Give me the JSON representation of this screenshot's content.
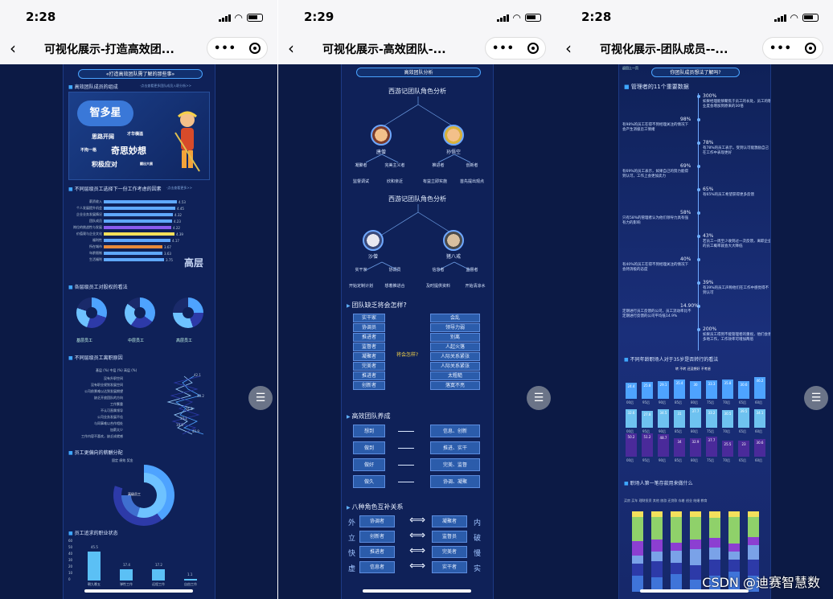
{
  "phones": [
    {
      "time": "2:28",
      "title": "可视化展示-打造高效团...",
      "banner": "«打造高效团队需了解的那些事»"
    },
    {
      "time": "2:29",
      "title": "可视化展示-高效团队-...",
      "banner": "高效团队分析"
    },
    {
      "time": "2:28",
      "title": "可视化展示-团队成员--...",
      "banner": "你团队成员想法了解吗?",
      "top_label": "返回上一页"
    }
  ],
  "p1": {
    "sec1": "高效团队成员的组成",
    "sec1_sub": "·点击查看更多团队成员入职分析>>",
    "speech": "智多星",
    "hero_words": [
      "思路开阔",
      "才华横溢",
      "不拘一格",
      "奇思妙想",
      "积极应对",
      "翻出大展"
    ],
    "sec2": "不同层级员工选择下一份工作考虑的因素",
    "sec2_sub": "·点击查看更多>>",
    "bars": [
      {
        "label": "薪资收入",
        "value": 4.53,
        "color": "#5fa8ff"
      },
      {
        "label": "个人发展提升机会",
        "value": 4.45,
        "color": "#5fa8ff"
      },
      {
        "label": "企业业务发展情况",
        "value": 4.32,
        "color": "#5fa8ff"
      },
      {
        "label": "团队成员",
        "value": 4.23,
        "color": "#5fa8ff"
      },
      {
        "label": "岗位的挑战性与发展",
        "value": 4.22,
        "color": "#8a5cf0"
      },
      {
        "label": "价值观与企业文化",
        "value": 4.39,
        "color": "#f5e05a"
      },
      {
        "label": "福利性",
        "value": 4.17,
        "color": "#5fa8ff"
      },
      {
        "label": "所在城市",
        "value": 3.67,
        "color": "#e98a3a"
      },
      {
        "label": "年龄限制",
        "value": 3.63,
        "color": "#5fa8ff"
      },
      {
        "label": "生活福利",
        "value": 3.75,
        "color": "#5fa8ff"
      }
    ],
    "big_tag": "高层",
    "sec3": "各层级员工对股权的看法",
    "donut_caps": [
      "基层员工",
      "中层员工",
      "高层员工"
    ],
    "sec4": "不同层级员工离职原因",
    "legend4": [
      "基层 (%)",
      "中层 (%)",
      "高层 (%)"
    ],
    "reasons": [
      "没有升职空间",
      "没有职业规划发展空间",
      "公司前景难以达到发展期望",
      "缺乏开放团队的方向",
      "工作繁重",
      "不认可直属领导",
      "公司业务发展不佳",
      "与同事难以合作相处",
      "加薪太少",
      "工作内容不喜欢，缺乏成就感"
    ],
    "line_vals": [
      "42.1",
      "40.2",
      "31.1",
      "30.2",
      "19.8",
      "45.9"
    ],
    "sec5": "员工更偏向的薪酬分配",
    "legend5": [
      "固定",
      "绩效",
      "奖金"
    ],
    "ring_label": "高级员工",
    "sec6": "员工追求的职业状态",
    "vbars": [
      {
        "label": "朝九晚五",
        "value": 45.5
      },
      {
        "label": "弹性工作",
        "value": 17.4
      },
      {
        "label": "远程工作",
        "value": 17.2
      },
      {
        "label": "自由工作",
        "value": 1.1
      }
    ],
    "vbar_ticks": [
      "60",
      "50",
      "40",
      "30",
      "20",
      "10",
      "0"
    ]
  },
  "p2": {
    "tree1_title": "西游记团队角色分析",
    "tree1_nodes": [
      "唐僧",
      "孙悟空"
    ],
    "tree1_leaves": [
      "凝聚者",
      "完美主义者",
      "推进者",
      "创新者"
    ],
    "tree1_leaves2": [
      "监督调试",
      "欣和亲近",
      "有益立即实施",
      "首先提出观点"
    ],
    "tree2_title": "西游记团队角色分析",
    "tree2_nodes": [
      "沙僧",
      "猪八戒"
    ],
    "tree2_leaves": [
      "实干家",
      "协调员",
      "信息者",
      "监督者"
    ],
    "tree2_leaves2": [
      "开始定制计划",
      "想着推进合",
      "及时提供资料",
      "开始清凉水"
    ],
    "sec1": "团队缺乏将会怎样?",
    "left_boxes": [
      "实干家",
      "协调员",
      "推进者",
      "监督者",
      "凝聚者",
      "完美者",
      "推进者",
      "创新者"
    ],
    "right_boxes": [
      "会乱",
      "领导力弱",
      "别离",
      "人起火落",
      "人际关系紧张",
      "人际关系紧张",
      "太粗糙",
      "落寞不亮"
    ],
    "center_label": "将会怎样?",
    "sec2": "高效团队养成",
    "habit_left": [
      "想到",
      "做到",
      "做好",
      "做久"
    ],
    "habit_right": [
      "信息、创新",
      "推进、实干",
      "完美、监督",
      "协调、凝聚"
    ],
    "sec3": "八种角色互补关系",
    "rel_left": [
      "协调者",
      "创新者",
      "推进者",
      "信息者"
    ],
    "rel_right": [
      "凝聚者",
      "监督员",
      "完美者",
      "实干者"
    ],
    "side_left": [
      "外",
      "立",
      "快",
      "虚"
    ],
    "side_right": [
      "内",
      "破",
      "慢",
      "实"
    ]
  },
  "p3": {
    "sec1": "管理者的11个重要数据",
    "tl": [
      {
        "pct": "300%",
        "text": "如果经理能够聚焦于员工的长处，员工的敬业度会增加到原来的30倍"
      },
      {
        "pct": "98%",
        "text": "有98%的员工在得不到经理关注的情况下会产生消极怠工情绪"
      },
      {
        "pct": "78%",
        "text": "有78%的员工表示，受到认可能激励自己在工作中表现更好"
      },
      {
        "pct": "69%",
        "text": "有69%的员工表示，如果自己的努力能得到认可，工作上会更加卖力"
      },
      {
        "pct": "65%",
        "text": "有65%的员工希望获得更多反馈"
      },
      {
        "pct": "58%",
        "text": "只有58%的管理者认为他们领导力具有强有力的影响"
      },
      {
        "pct": "43%",
        "text": "若员工一周至少收到过一次反馈，离职企业的员工概率就会大大降低"
      },
      {
        "pct": "40%",
        "text": "有40%的员工在得不到经理关注的情况下会持消极的态度"
      },
      {
        "pct": "39%",
        "text": "有39%的员工声称他们在工作中感觉得不到认可"
      },
      {
        "pct": "14.90%",
        "text": "定期进行员工反馈的公司，员工流动率比不定期进行反馈的公司平均低14.9%"
      },
      {
        "pct": "200%",
        "text": "如果员工得到不能管理者的重视，他们会更多地工作，工作效率可增加两倍"
      }
    ],
    "sec2": "不同年龄职场人对于35岁是否转行的看法",
    "row1": [
      "24.4",
      "25.8",
      "29.1",
      "35.4",
      "30",
      "33.3",
      "35.8",
      "30.6",
      "46.2"
    ],
    "row2": [
      "32.6",
      "27.8",
      "34.5",
      "31",
      "37.7",
      "33.2",
      "30.5",
      "39.5",
      "34.1"
    ],
    "row3": [
      "50.2",
      "51.2",
      "48.7",
      "34",
      "32.9",
      "37.7",
      "25.5",
      "23",
      "30.6"
    ],
    "ages": [
      "00后",
      "95后",
      "90后",
      "85后",
      "80后",
      "75后",
      "70后",
      "65后",
      "60后"
    ],
    "legend2": [
      "转",
      "不转",
      "还没想好",
      "不考虑"
    ],
    "sec3": "职场人第一笔存款用来做什么",
    "legend3": [
      "买房",
      "买车",
      "理财投资",
      "其他",
      "旅游",
      "还贷款",
      "存着",
      "创业",
      "结婚",
      "教育"
    ],
    "stacks": [
      [
        20,
        15,
        10,
        18,
        30,
        7
      ],
      [
        18,
        20,
        12,
        15,
        28,
        7
      ],
      [
        22,
        14,
        15,
        10,
        32,
        7
      ],
      [
        15,
        18,
        20,
        12,
        28,
        7
      ],
      [
        20,
        20,
        15,
        12,
        25,
        8
      ],
      [
        25,
        15,
        10,
        10,
        33,
        7
      ],
      [
        20,
        20,
        18,
        10,
        25,
        7
      ]
    ],
    "stack_colors": [
      "#3f74d9",
      "#2d3aa8",
      "#7aa2e8",
      "#8c3fd1",
      "#8fd16a",
      "#f3e05c"
    ]
  },
  "watermark": "CSDN @迪赛智慧数"
}
